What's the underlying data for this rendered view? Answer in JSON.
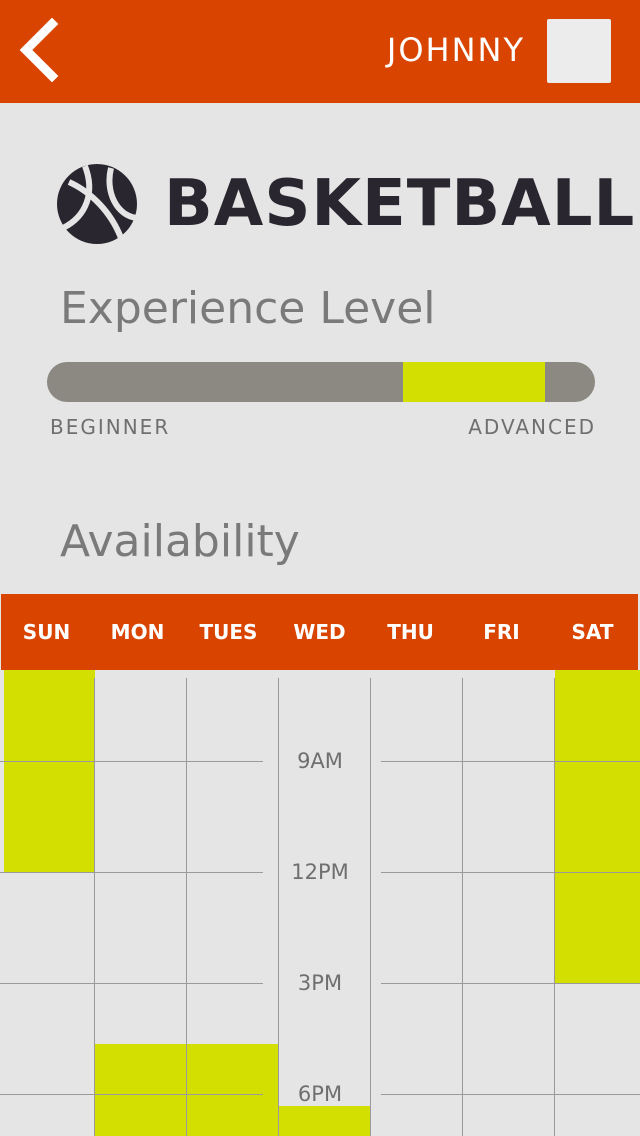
{
  "header": {
    "back_icon": "chevron-left-icon",
    "username": "JOHNNY",
    "avatar_color": "#ececec",
    "background": "#d94400"
  },
  "sport": {
    "icon": "basketball-icon",
    "name": "BASKETBALL"
  },
  "experience": {
    "title": "Experience Level",
    "min_label": "BEGINNER",
    "max_label": "ADVANCED",
    "selected_range": [
      0.65,
      0.91
    ],
    "fill_color": "#d3df00"
  },
  "availability": {
    "title": "Availability",
    "days": [
      "SUN",
      "MON",
      "TUES",
      "WED",
      "THU",
      "FRI",
      "SAT"
    ],
    "time_labels": [
      "9AM",
      "12PM",
      "3PM",
      "6PM"
    ],
    "slots": [
      {
        "day": "SUN",
        "start": "6AM",
        "end": "12PM"
      },
      {
        "day": "MON",
        "start": "5PM",
        "end": "7PM"
      },
      {
        "day": "TUES",
        "start": "5PM",
        "end": "7PM"
      },
      {
        "day": "WED",
        "start": "6:30PM",
        "end": "7PM"
      },
      {
        "day": "SAT",
        "start": "6AM",
        "end": "3PM"
      }
    ],
    "highlight_color": "#d3df00"
  }
}
